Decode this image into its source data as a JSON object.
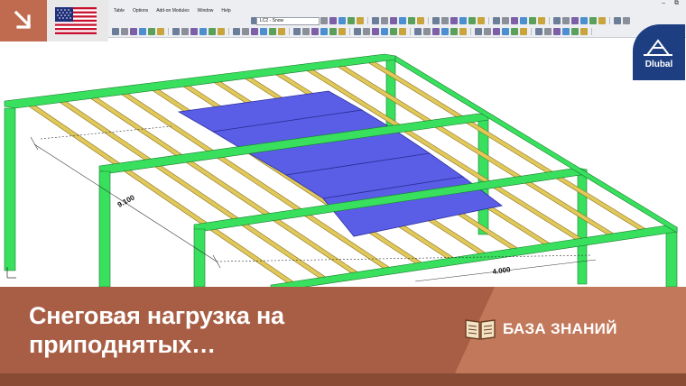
{
  "toolbar": {
    "menu_items": [
      "Table",
      "Options",
      "Add-on Modules",
      "Window",
      "Help"
    ],
    "loadcase_value": "LC2 - Snow",
    "window_controls": [
      "–",
      "⧉"
    ]
  },
  "dimensions": {
    "left_span": "9.100",
    "front_span": "4.000"
  },
  "logo": {
    "text": "Dlubal"
  },
  "banner": {
    "title_line1": "Снеговая нагрузка на",
    "title_line2": "приподнятых…",
    "kb_label": "БАЗА ЗНАНИЙ"
  },
  "colors": {
    "accent": "#c06a4f",
    "banner": "#b5694c",
    "banner_dark": "#8a4b35",
    "column_green": "#38e05e",
    "purlin_yellow": "#e1c85a",
    "roof_blue": "#5a5ee6",
    "logo_blue": "#1d3f82"
  },
  "icons": {
    "corner": "arrow-down-right-icon",
    "flag": "us-flag-icon",
    "book": "open-book-icon"
  }
}
